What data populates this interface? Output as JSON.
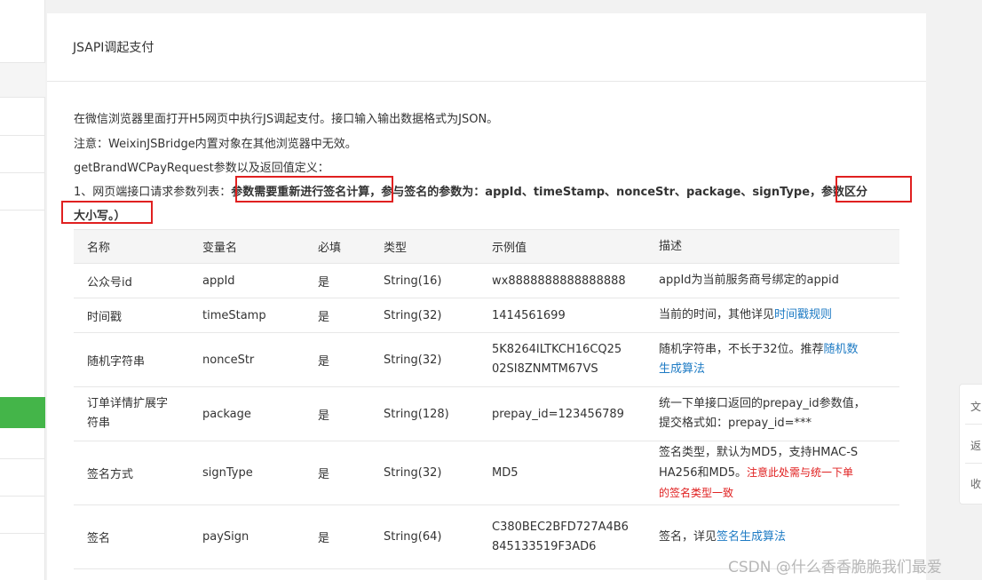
{
  "panel": {
    "title": "JSAPI调起支付",
    "intro": [
      "在微信浏览器里面打开H5网页中执行JS调起支付。接口输入输出数据格式为JSON。",
      "注意：WeixinJSBridge内置对象在其他浏览器中无效。",
      "getBrandWCPayRequest参数以及返回值定义："
    ],
    "params_line": {
      "prefix": "1、网页端接口请求参数列表：",
      "highlight1": "参数需要重新进行签名计算",
      "middle": "，参与签名的参数为：appId、timeStamp、nonceStr、package、signType",
      "highlight2": "，参数区分",
      "tail": "大小写。）"
    }
  },
  "table": {
    "headers": [
      "名称",
      "变量名",
      "必填",
      "类型",
      "示例值",
      "描述"
    ],
    "rows": [
      {
        "name": "公众号id",
        "var": "appId",
        "required": "是",
        "type": "String(16)",
        "example": "wx8888888888888888",
        "desc": "appId为当前服务商号绑定的appid"
      },
      {
        "name": "时间戳",
        "var": "timeStamp",
        "required": "是",
        "type": "String(32)",
        "example": "1414561699",
        "desc": "当前的时间，其他详见",
        "desc_link": "时间戳规则"
      },
      {
        "name": "随机字符串",
        "var": "nonceStr",
        "required": "是",
        "type": "String(32)",
        "example_l1": "5K8264ILTKCH16CQ25",
        "example_l2": "02SI8ZNMTM67VS",
        "desc": "随机字符串，不长于32位。推荐",
        "desc_link_l1": "随机数",
        "desc_link_l2": "生成算法"
      },
      {
        "name_l1": "订单详情扩展字",
        "name_l2": "符串",
        "var": "package",
        "required": "是",
        "type": "String(128)",
        "example": "prepay_id=123456789",
        "desc_l1": "统一下单接口返回的prepay_id参数值，",
        "desc_l2": "提交格式如：prepay_id=***"
      },
      {
        "name": "签名方式",
        "var": "signType",
        "required": "是",
        "type": "String(32)",
        "example": "MD5",
        "desc_l1": "签名类型，默认为MD5，支持HMAC-S",
        "desc_l2a": "HA256和MD5。",
        "desc_red1": "注意此处需与统一下单",
        "desc_red2": "的签名类型一致"
      },
      {
        "name": "签名",
        "var": "paySign",
        "required": "是",
        "type": "String(64)",
        "example_l1": "C380BEC2BFD727A4B6",
        "example_l2": "845133519F3AD6",
        "desc": "签名，详见",
        "desc_link": "签名生成算法"
      }
    ]
  },
  "float": {
    "items": [
      "文",
      "返",
      "收"
    ]
  },
  "watermark": "CSDN @什么香香脆脆我们最爱",
  "colors": {
    "accent": "#44b549",
    "link": "#1e7bc4",
    "warn": "#e02020"
  }
}
